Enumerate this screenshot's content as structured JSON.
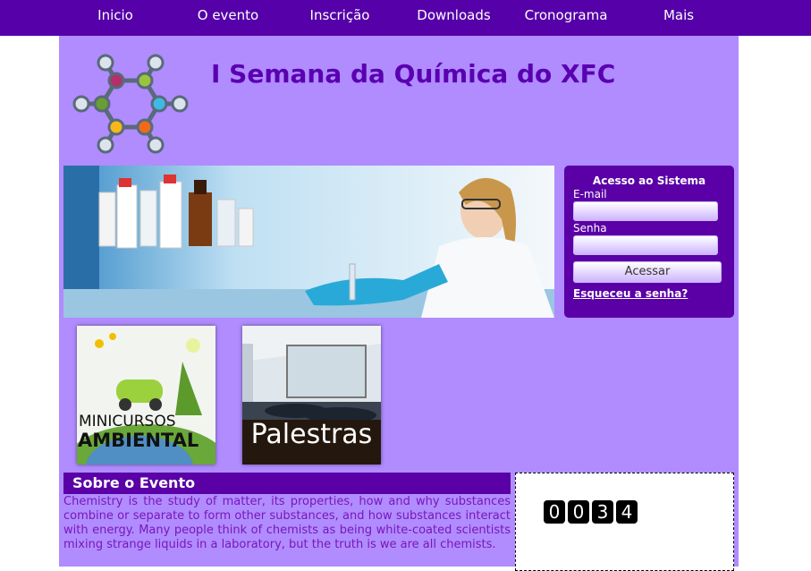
{
  "nav": {
    "items": [
      "Inicio",
      "O evento",
      "Inscrição",
      "Downloads",
      "Cronograma",
      "Mais"
    ]
  },
  "header": {
    "title": "I Semana da Química do XFC",
    "logo_icon": "molecule-logo-icon"
  },
  "hero": {
    "image": "chemist-lab-photo"
  },
  "login": {
    "title": "Acesso ao Sistema",
    "email_label": "E-mail",
    "email_value": "",
    "password_label": "Senha",
    "password_value": "",
    "submit_label": "Acessar",
    "forgot_label": "Esqueceu a senha?"
  },
  "thumbs": [
    {
      "line1": "MINICURSOS",
      "line2": "AMBIENTAL"
    },
    {
      "line1": "Palestras"
    }
  ],
  "about": {
    "title": "Sobre o Evento",
    "text": "Chemistry is the study of matter, its properties, how and why substances combine or separate to form other substances, and how substances interact with energy. Many people think of chemists as being white-coated scientists mixing strange liquids in a laboratory, but the truth is we are all chemists."
  },
  "counter": {
    "digits": [
      "0",
      "0",
      "3",
      "4"
    ]
  },
  "colors": {
    "nav_bg": "#5500a8",
    "panel_bg": "#b08cff",
    "accent": "#5a00a6",
    "title": "#5a00b0",
    "about_text": "#7a16b8"
  }
}
